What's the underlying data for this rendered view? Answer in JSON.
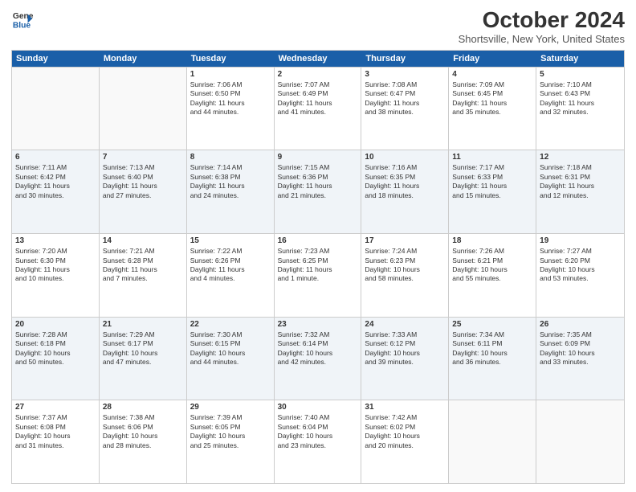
{
  "logo": {
    "line1": "General",
    "line2": "Blue"
  },
  "title": "October 2024",
  "location": "Shortsville, New York, United States",
  "days_of_week": [
    "Sunday",
    "Monday",
    "Tuesday",
    "Wednesday",
    "Thursday",
    "Friday",
    "Saturday"
  ],
  "weeks": [
    [
      {
        "day": "",
        "info": ""
      },
      {
        "day": "",
        "info": ""
      },
      {
        "day": "1",
        "info": "Sunrise: 7:06 AM\nSunset: 6:50 PM\nDaylight: 11 hours\nand 44 minutes."
      },
      {
        "day": "2",
        "info": "Sunrise: 7:07 AM\nSunset: 6:49 PM\nDaylight: 11 hours\nand 41 minutes."
      },
      {
        "day": "3",
        "info": "Sunrise: 7:08 AM\nSunset: 6:47 PM\nDaylight: 11 hours\nand 38 minutes."
      },
      {
        "day": "4",
        "info": "Sunrise: 7:09 AM\nSunset: 6:45 PM\nDaylight: 11 hours\nand 35 minutes."
      },
      {
        "day": "5",
        "info": "Sunrise: 7:10 AM\nSunset: 6:43 PM\nDaylight: 11 hours\nand 32 minutes."
      }
    ],
    [
      {
        "day": "6",
        "info": "Sunrise: 7:11 AM\nSunset: 6:42 PM\nDaylight: 11 hours\nand 30 minutes."
      },
      {
        "day": "7",
        "info": "Sunrise: 7:13 AM\nSunset: 6:40 PM\nDaylight: 11 hours\nand 27 minutes."
      },
      {
        "day": "8",
        "info": "Sunrise: 7:14 AM\nSunset: 6:38 PM\nDaylight: 11 hours\nand 24 minutes."
      },
      {
        "day": "9",
        "info": "Sunrise: 7:15 AM\nSunset: 6:36 PM\nDaylight: 11 hours\nand 21 minutes."
      },
      {
        "day": "10",
        "info": "Sunrise: 7:16 AM\nSunset: 6:35 PM\nDaylight: 11 hours\nand 18 minutes."
      },
      {
        "day": "11",
        "info": "Sunrise: 7:17 AM\nSunset: 6:33 PM\nDaylight: 11 hours\nand 15 minutes."
      },
      {
        "day": "12",
        "info": "Sunrise: 7:18 AM\nSunset: 6:31 PM\nDaylight: 11 hours\nand 12 minutes."
      }
    ],
    [
      {
        "day": "13",
        "info": "Sunrise: 7:20 AM\nSunset: 6:30 PM\nDaylight: 11 hours\nand 10 minutes."
      },
      {
        "day": "14",
        "info": "Sunrise: 7:21 AM\nSunset: 6:28 PM\nDaylight: 11 hours\nand 7 minutes."
      },
      {
        "day": "15",
        "info": "Sunrise: 7:22 AM\nSunset: 6:26 PM\nDaylight: 11 hours\nand 4 minutes."
      },
      {
        "day": "16",
        "info": "Sunrise: 7:23 AM\nSunset: 6:25 PM\nDaylight: 11 hours\nand 1 minute."
      },
      {
        "day": "17",
        "info": "Sunrise: 7:24 AM\nSunset: 6:23 PM\nDaylight: 10 hours\nand 58 minutes."
      },
      {
        "day": "18",
        "info": "Sunrise: 7:26 AM\nSunset: 6:21 PM\nDaylight: 10 hours\nand 55 minutes."
      },
      {
        "day": "19",
        "info": "Sunrise: 7:27 AM\nSunset: 6:20 PM\nDaylight: 10 hours\nand 53 minutes."
      }
    ],
    [
      {
        "day": "20",
        "info": "Sunrise: 7:28 AM\nSunset: 6:18 PM\nDaylight: 10 hours\nand 50 minutes."
      },
      {
        "day": "21",
        "info": "Sunrise: 7:29 AM\nSunset: 6:17 PM\nDaylight: 10 hours\nand 47 minutes."
      },
      {
        "day": "22",
        "info": "Sunrise: 7:30 AM\nSunset: 6:15 PM\nDaylight: 10 hours\nand 44 minutes."
      },
      {
        "day": "23",
        "info": "Sunrise: 7:32 AM\nSunset: 6:14 PM\nDaylight: 10 hours\nand 42 minutes."
      },
      {
        "day": "24",
        "info": "Sunrise: 7:33 AM\nSunset: 6:12 PM\nDaylight: 10 hours\nand 39 minutes."
      },
      {
        "day": "25",
        "info": "Sunrise: 7:34 AM\nSunset: 6:11 PM\nDaylight: 10 hours\nand 36 minutes."
      },
      {
        "day": "26",
        "info": "Sunrise: 7:35 AM\nSunset: 6:09 PM\nDaylight: 10 hours\nand 33 minutes."
      }
    ],
    [
      {
        "day": "27",
        "info": "Sunrise: 7:37 AM\nSunset: 6:08 PM\nDaylight: 10 hours\nand 31 minutes."
      },
      {
        "day": "28",
        "info": "Sunrise: 7:38 AM\nSunset: 6:06 PM\nDaylight: 10 hours\nand 28 minutes."
      },
      {
        "day": "29",
        "info": "Sunrise: 7:39 AM\nSunset: 6:05 PM\nDaylight: 10 hours\nand 25 minutes."
      },
      {
        "day": "30",
        "info": "Sunrise: 7:40 AM\nSunset: 6:04 PM\nDaylight: 10 hours\nand 23 minutes."
      },
      {
        "day": "31",
        "info": "Sunrise: 7:42 AM\nSunset: 6:02 PM\nDaylight: 10 hours\nand 20 minutes."
      },
      {
        "day": "",
        "info": ""
      },
      {
        "day": "",
        "info": ""
      }
    ]
  ]
}
